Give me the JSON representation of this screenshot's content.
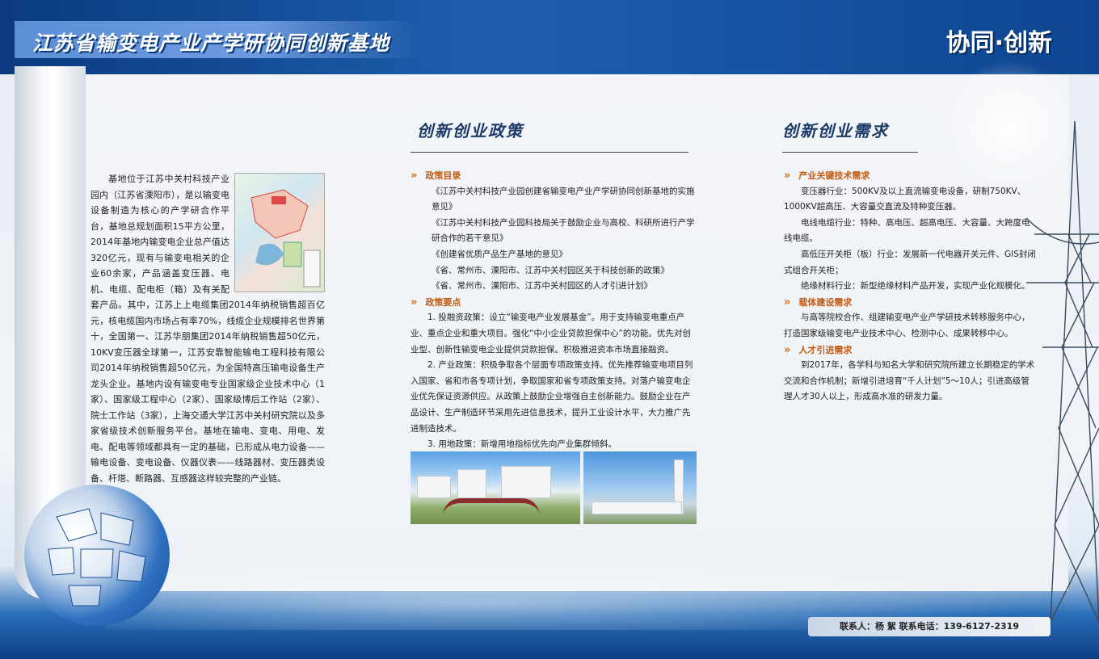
{
  "header": {
    "title": "江苏省输变电产业产学研协同创新基地",
    "slogan": "协同·创新"
  },
  "left_column": {
    "paragraphs": [
      "基地位于江苏中关村科技产业园内（江苏省溧阳市），是以输变电设备制造为核心的产学研合作平台，基地总规划面积15平方公里，2014年基地内输变电企业总产值达320亿元，现有与输变电相关的企业60余家，产品涵盖变压器、电机、电缆、配电柜（箱）及有关配套产品。其中，江苏上上电缆集团2014年纳税销售超百亿元，核电缆国内市场占有率70%，线缆企业规模排名世界第十，全国第一、江苏华朋集团2014年纳税销售超50亿元，10KV变压器全球第一，江苏安靠智能输电工程科技有限公司2014年纳税销售超50亿元，为全国特高压输电设备生产龙头企业。基地内设有输变电专业国家级企业技术中心（1家）、国家级工程中心（2家）、国家级博后工作站（2家）、院士工作站（3家），上海交通大学江苏中关村研究院以及多家省级技术创新服务平台。基地在输电、变电、用电、发电、配电等领域都具有一定的基础，已形成从电力设备——输电设备、变电设备、仪器仪表——线路器材、变压器类设备、杆塔、断路器、互感器这样较完整的产业链。"
    ]
  },
  "policy": {
    "title": "创新创业政策",
    "catalog_heading": "政策目录",
    "catalog_items": [
      "《江苏中关村科技产业园创建省输变电产业产学研协同创新基地的实施意见》",
      "《江苏中关村科技产业园科技局关于鼓励企业与高校、科研所进行产学研合作的若干意见》",
      "《创建省优质产品生产基地的意见》",
      "《省、常州市、溧阳市、江苏中关村园区关于科技创新的政策》",
      "《省、常州市、溧阳市、江苏中关村园区的人才引进计划》"
    ],
    "points_heading": "政策要点",
    "points": [
      "1. 投融资政策：设立“输变电产业发展基金”。用于支持输变电重点产业、重点企业和重大项目。强化“中小企业贷款担保中心”的功能。优先对创业型、创新性输变电企业提供贷款担保。积极推进资本市场直接融资。",
      "2. 产业政策：积极争取各个层面专项政策支持。优先推荐输变电项目列入国家、省和市各专项计划，争取国家和省专项政策支持。对落户输变电企业优先保证资源供应。从政策上鼓励企业增强自主创新能力。鼓励企业在产品设计、生产制造环节采用先进信息技术，提升工业设计水平，大力推广先进制造技术。",
      "3. 用地政策：新增用地指标优先向产业集群倾斜。"
    ]
  },
  "demand": {
    "title": "创新创业需求",
    "tech_heading": "产业关键技术需求",
    "tech_items": [
      "变压器行业：500KV及以上直流输变电设备，研制750KV、1000KV超高压、大容量交直流及特种变压器。",
      "电线电缆行业：特种、高电压、超高电压、大容量、大跨度电线电缆。",
      "高低压开关柜（板）行业：发展新一代电器开关元件、GIS封闭式组合开关柜；",
      "绝缘材料行业：新型绝缘材料产品开发，实现产业化规模化。"
    ],
    "carrier_heading": "载体建设需求",
    "carrier_text": "与高等院校合作、组建输变电产业产学研技术转移服务中心，打造国家级输变电产业技术中心、检测中心、成果转移中心。",
    "talent_heading": "人才引进需求",
    "talent_text": "到2017年，各学科与知名大学和研究院所建立长期稳定的学术交流和合作机制；新增引进培育“千人计划”5～10人；引进高级管理人才30人以上，形成高水准的研发力量。"
  },
  "footer": {
    "contact": "联系人：杨 絮    联系电话：139-6127-2319"
  }
}
